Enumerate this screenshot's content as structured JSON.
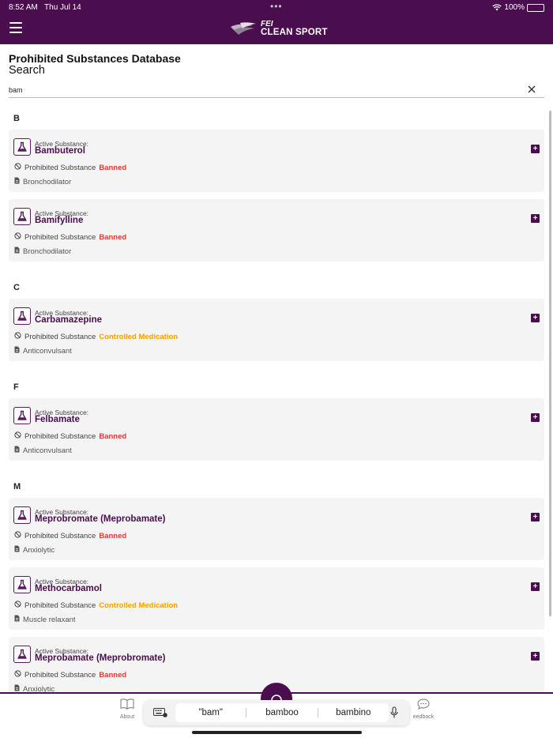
{
  "status_bar": {
    "time": "8:52 AM",
    "date": "Thu Jul 14",
    "battery": "100%"
  },
  "header": {
    "logo_top": "FEI",
    "logo_bottom": "CLEAN SPORT"
  },
  "page": {
    "title": "Prohibited Substances Database",
    "search_label": "Search"
  },
  "search": {
    "value": "bam"
  },
  "sections": [
    {
      "letter": "B",
      "items": [
        {
          "label": "Active Substance:",
          "name": "Bambuterol",
          "prohibited_label": "Prohibited Substance",
          "status": "Banned",
          "status_type": "banned",
          "classification": "Bronchodilator"
        },
        {
          "label": "Active Substance:",
          "name": "Bamifylline",
          "prohibited_label": "Prohibited Substance",
          "status": "Banned",
          "status_type": "banned",
          "classification": "Bronchodilator"
        }
      ]
    },
    {
      "letter": "C",
      "items": [
        {
          "label": "Active Substance:",
          "name": "Carbamazepine",
          "prohibited_label": "Prohibited Substance",
          "status": "Controlled Medication",
          "status_type": "controlled",
          "classification": "Anticonvulsant"
        }
      ]
    },
    {
      "letter": "F",
      "items": [
        {
          "label": "Active Substance:",
          "name": "Felbamate",
          "prohibited_label": "Prohibited Substance",
          "status": "Banned",
          "status_type": "banned",
          "classification": "Anticonvulsant"
        }
      ]
    },
    {
      "letter": "M",
      "items": [
        {
          "label": "Active Substance:",
          "name": "Meprobromate (Meprobamate)",
          "prohibited_label": "Prohibited Substance",
          "status": "Banned",
          "status_type": "banned",
          "classification": "Anxiolytic"
        },
        {
          "label": "Active Substance:",
          "name": "Methocarbamol",
          "prohibited_label": "Prohibited Substance",
          "status": "Controlled Medication",
          "status_type": "controlled",
          "classification": "Muscle relaxant"
        },
        {
          "label": "Active Substance:",
          "name": "Meprobamate (Meprobromate)",
          "prohibited_label": "Prohibited Substance",
          "status": "Banned",
          "status_type": "banned",
          "classification": "Anxiolytic"
        }
      ]
    }
  ],
  "bottom_nav": {
    "about_label": "About",
    "feedback_label": "eedback"
  },
  "keyboard": {
    "suggestions": [
      "\"bam\"",
      "bamboo",
      "bambino"
    ]
  },
  "colors": {
    "brand": "#4a0e4e",
    "banned": "#e23b2e",
    "controlled": "#f5a000"
  }
}
